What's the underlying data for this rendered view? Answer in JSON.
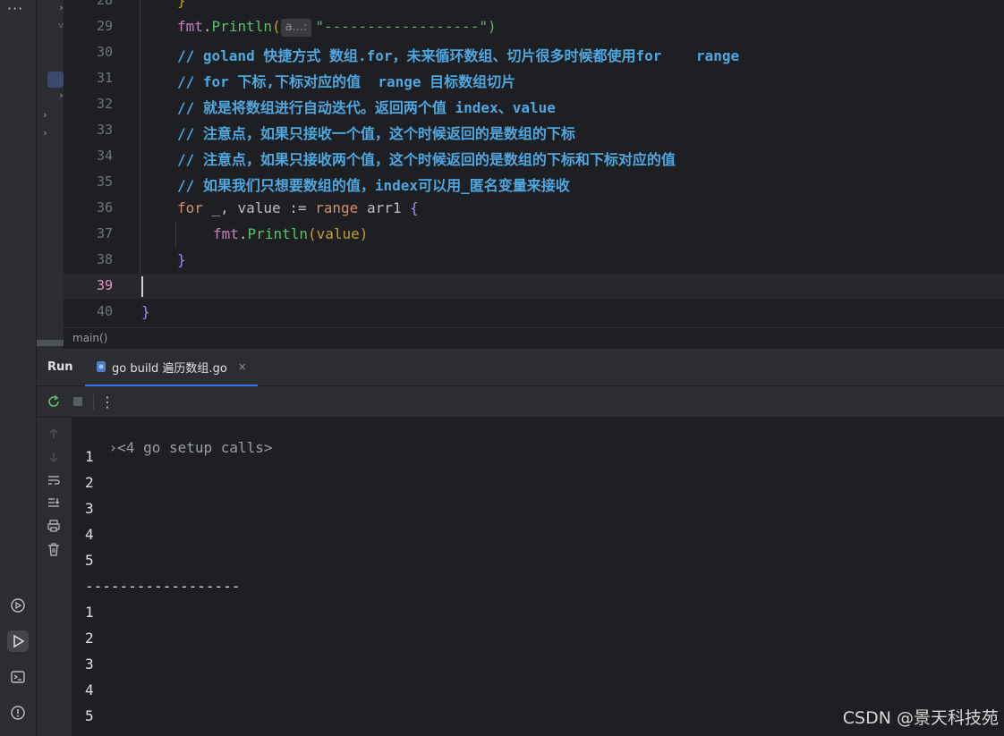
{
  "editor": {
    "lines": [
      {
        "num": "28",
        "kind": "brace_close_partial",
        "text": "}"
      },
      {
        "num": "29",
        "kind": "println",
        "pkg": "fmt",
        "fn": "Println",
        "hint": "a...:",
        "str": "\"------------------\")"
      },
      {
        "num": "30",
        "kind": "comment",
        "text": "// goland 快捷方式 数组.for，未来循环数组、切片很多时候都使用for    range"
      },
      {
        "num": "31",
        "kind": "comment",
        "text": "// for 下标,下标对应的值  range 目标数组切片"
      },
      {
        "num": "32",
        "kind": "comment",
        "text": "// 就是将数组进行自动迭代。返回两个值 index、value"
      },
      {
        "num": "33",
        "kind": "comment",
        "text": "// 注意点，如果只接收一个值，这个时候返回的是数组的下标"
      },
      {
        "num": "34",
        "kind": "comment",
        "text": "// 注意点，如果只接收两个值，这个时候返回的是数组的下标和下标对应的值"
      },
      {
        "num": "35",
        "kind": "comment",
        "text": "// 如果我们只想要数组的值，index可以用_匿名变量来接收"
      },
      {
        "num": "36",
        "kind": "for",
        "kw": "for",
        "mid": " _, value := ",
        "kw2": "range",
        "rest": " arr1 ",
        "brace": "{"
      },
      {
        "num": "37",
        "kind": "call",
        "pkg": "fmt",
        "fn": "Println",
        "args": "(value)"
      },
      {
        "num": "38",
        "kind": "brace",
        "text": "}"
      },
      {
        "num": "39",
        "kind": "current",
        "text": ""
      },
      {
        "num": "40",
        "kind": "brace_outer",
        "text": "}"
      }
    ],
    "breadcrumb": "main()"
  },
  "run": {
    "title": "Run",
    "tab_label": "go build 遍历数组.go",
    "close_glyph": "×",
    "more_glyph": "⋮"
  },
  "console": {
    "setup": "<4 go setup calls>",
    "output": [
      "1",
      "2",
      "3",
      "4",
      "5",
      "------------------",
      "1",
      "2",
      "3",
      "4",
      "5"
    ]
  },
  "watermark": "CSDN @景天科技苑",
  "left_dots": "···"
}
